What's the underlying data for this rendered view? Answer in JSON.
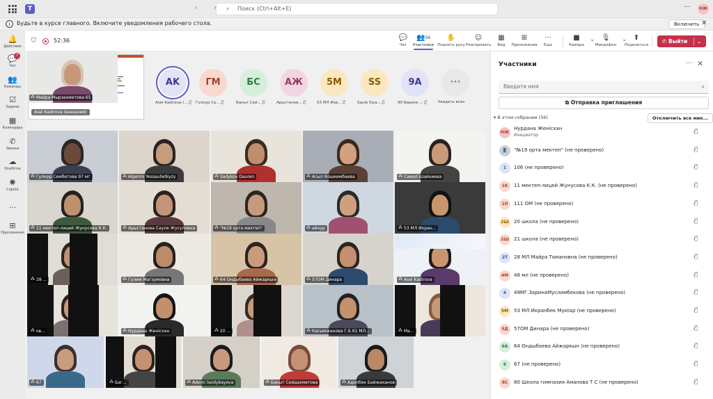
{
  "top": {
    "search": "Поиск (Ctrl+Alt+E)",
    "more": "···",
    "avatar": "НЖ",
    "nav": "‹ ›"
  },
  "notification": {
    "text": "Будьте в курсе главного. Включите уведомления рабочего стола.",
    "enable": "Включить",
    "close": "✕"
  },
  "rail": [
    {
      "label": "Действие",
      "icon": "bell-icon",
      "glyph": "🔔"
    },
    {
      "label": "Чат",
      "icon": "chat-icon",
      "glyph": "💬",
      "badge": "7"
    },
    {
      "label": "Команды",
      "icon": "teams-icon",
      "glyph": "👥"
    },
    {
      "label": "Задачи",
      "icon": "tasks-icon",
      "glyph": "☑"
    },
    {
      "label": "Календарь",
      "icon": "calendar-icon",
      "glyph": "▦"
    },
    {
      "label": "Звонки",
      "icon": "phone-icon",
      "glyph": "✆"
    },
    {
      "label": "OneDrive",
      "icon": "cloud-icon",
      "glyph": "☁"
    },
    {
      "label": "Copilot",
      "icon": "copilot-icon",
      "glyph": "✺"
    },
    {
      "label": "",
      "icon": "more-icon",
      "glyph": "···"
    },
    {
      "label": "Приложения",
      "icon": "apps-icon",
      "glyph": "⊞"
    }
  ],
  "meeting": {
    "timer": "52:36",
    "controls": [
      {
        "label": "Чат",
        "icon": "chat-icon",
        "glyph": "💬"
      },
      {
        "label": "Участники",
        "icon": "people-icon",
        "glyph": "👥",
        "count": "56"
      },
      {
        "label": "Поднять руку",
        "icon": "hand-icon",
        "glyph": "✋"
      },
      {
        "label": "Реагировать",
        "icon": "emoji-icon",
        "glyph": "☺"
      },
      {
        "label": "Вид",
        "icon": "grid-icon",
        "glyph": "▦"
      },
      {
        "label": "Приложения",
        "icon": "plus-box-icon",
        "glyph": "⊞"
      },
      {
        "label": "Еще",
        "icon": "more-icon",
        "glyph": "···"
      },
      {
        "label": "Камера",
        "icon": "camera-icon",
        "glyph": "■"
      },
      {
        "label": "Микрофон",
        "icon": "mic-off-icon",
        "glyph": "🎙"
      },
      {
        "label": "Поделиться",
        "icon": "share-icon",
        "glyph": "⬆"
      }
    ],
    "leave": "Выйти",
    "leave_chevron": "⌄"
  },
  "share": {
    "presenter": "Asel Kadirova (внешний)"
  },
  "gallery": [
    {
      "initials": "AK",
      "name": "Asel Kadirova (...",
      "bg": "#e3e3f7",
      "fg": "#3c3c8c",
      "ring": "#5b5fc7"
    },
    {
      "initials": "ГМ",
      "name": "Гулнур Се...",
      "bg": "#f9d8cf",
      "fg": "#a0432b"
    },
    {
      "initials": "БС",
      "name": "Бакыт Сей...",
      "bg": "#d6eedb",
      "fg": "#2e7d43"
    },
    {
      "initials": "АЖ",
      "name": "Арыстанов...",
      "bg": "#f3d6e2",
      "fg": "#9c3a63"
    },
    {
      "initials": "5М",
      "name": "53 МЛ Икр...",
      "bg": "#fbe8c2",
      "fg": "#8a5a00"
    },
    {
      "initials": "SS",
      "name": "Saule Slya...",
      "bg": "#fbe8c2",
      "fg": "#8a5a00"
    },
    {
      "initials": "9А",
      "name": "90 Береке ...",
      "bg": "#e3e3f7",
      "fg": "#3c3c8c"
    },
    {
      "initials": "···",
      "name": "Увидеть всех",
      "bg": "#e8e8e8",
      "fg": "#888888"
    }
  ],
  "tiles": [
    {
      "name": "Гулнур Сембетова 97 мг"
    },
    {
      "name": "Algerim Yessaulietkyzy"
    },
    {
      "name": "Sadykov Dauren"
    },
    {
      "name": "Асыл Кошкимбаева"
    },
    {
      "name": "Самал Шайхиева"
    },
    {
      "name": "11 мектеп-лицей Жунусова К.К."
    },
    {
      "name": "Арыстанова Сауле Жусуповна"
    },
    {
      "name": "\"№19 орта мектеп\""
    },
    {
      "name": "айнур"
    },
    {
      "name": "53 МЛ Икран..."
    },
    {
      "name": "28 ..."
    },
    {
      "name": "Гулим Магзумовна"
    },
    {
      "name": "64 Ондыбаева Айжаркын"
    },
    {
      "name": "57ОМ Динара"
    },
    {
      "name": "Asel Kadirova"
    },
    {
      "name": "ов..."
    },
    {
      "name": "Нурдана Женiсхан"
    },
    {
      "name": "20 ..."
    },
    {
      "name": "Касымжанова Г.Б 61 МЛ..."
    },
    {
      "name": "Ма..."
    },
    {
      "name": "67"
    },
    {
      "name": "Баг..."
    },
    {
      "name": "Ademi Seidybayeva"
    },
    {
      "name": "Бакыт Сейдахметова"
    },
    {
      "name": "Адилбек Байжаханов"
    },
    {
      "name": "Майра Мырзахметова 65"
    }
  ],
  "panel": {
    "title": "Участники",
    "more": "···",
    "close": "✕",
    "invite_placeholder": "Введите имя",
    "share_invite": "Отправка приглашения",
    "section": "В этом собрании (56)",
    "mute_all": "Отключить все мик...",
    "participants": [
      {
        "initials": "НЖ",
        "name": "Нурдана Женiсхан",
        "role": "Инициатор",
        "bg": "#f4c4c4",
        "fg": "#b83c3c"
      },
      {
        "initials": "👤",
        "name": "\"№19 орта мектеп\" (не проверено)",
        "bg": "#cfcfcf",
        "fg": "#616161"
      },
      {
        "initials": "1",
        "name": "106 (не проверено)",
        "bg": "#dde4f5",
        "fg": "#3a5a9c"
      },
      {
        "initials": "1К",
        "name": "11 мектеп-лицей Жунусова К.К. (не проверено)",
        "bg": "#f9d8cf",
        "fg": "#a0432b"
      },
      {
        "initials": "1О",
        "name": "111 ОМ (не проверено)",
        "bg": "#f9d8cf",
        "fg": "#a0432b"
      },
      {
        "initials": "2Ш",
        "name": "20 школа (не проверено)",
        "bg": "#fbe8c2",
        "fg": "#8a5a00"
      },
      {
        "initials": "2Ш",
        "name": "21 школа (не проверено)",
        "bg": "#f9d8cf",
        "fg": "#a0432b"
      },
      {
        "initials": "2Т",
        "name": "28 МЛ Майра Томановна (не проверено)",
        "bg": "#dde4f5",
        "fg": "#3a5a9c"
      },
      {
        "initials": "4М",
        "name": "48 мл (не проверено)",
        "bg": "#f9d8cf",
        "fg": "#a0432b"
      },
      {
        "initials": "4",
        "name": "49МГ.ЗаринаМуслимбекова (не проверено)",
        "bg": "#dde4f5",
        "fg": "#3a5a9c"
      },
      {
        "initials": "5М",
        "name": "53 МЛ Икранбек Мукtар (не проверено)",
        "bg": "#fbe8c2",
        "fg": "#8a5a00"
      },
      {
        "initials": "5Д",
        "name": "57ОМ Динара (не проверено)",
        "bg": "#f9d8cf",
        "fg": "#a0432b"
      },
      {
        "initials": "6А",
        "name": "64 Ондыбаева Айжаркын (не проверено)",
        "bg": "#d6eedb",
        "fg": "#2e7d43"
      },
      {
        "initials": "6",
        "name": "67 (не проверено)",
        "bg": "#d6eedb",
        "fg": "#2e7d43"
      },
      {
        "initials": "8С",
        "name": "80 Школа гимназия Аманова Т С (не проверено)",
        "bg": "#f9d8cf",
        "fg": "#a0432b"
      }
    ]
  }
}
